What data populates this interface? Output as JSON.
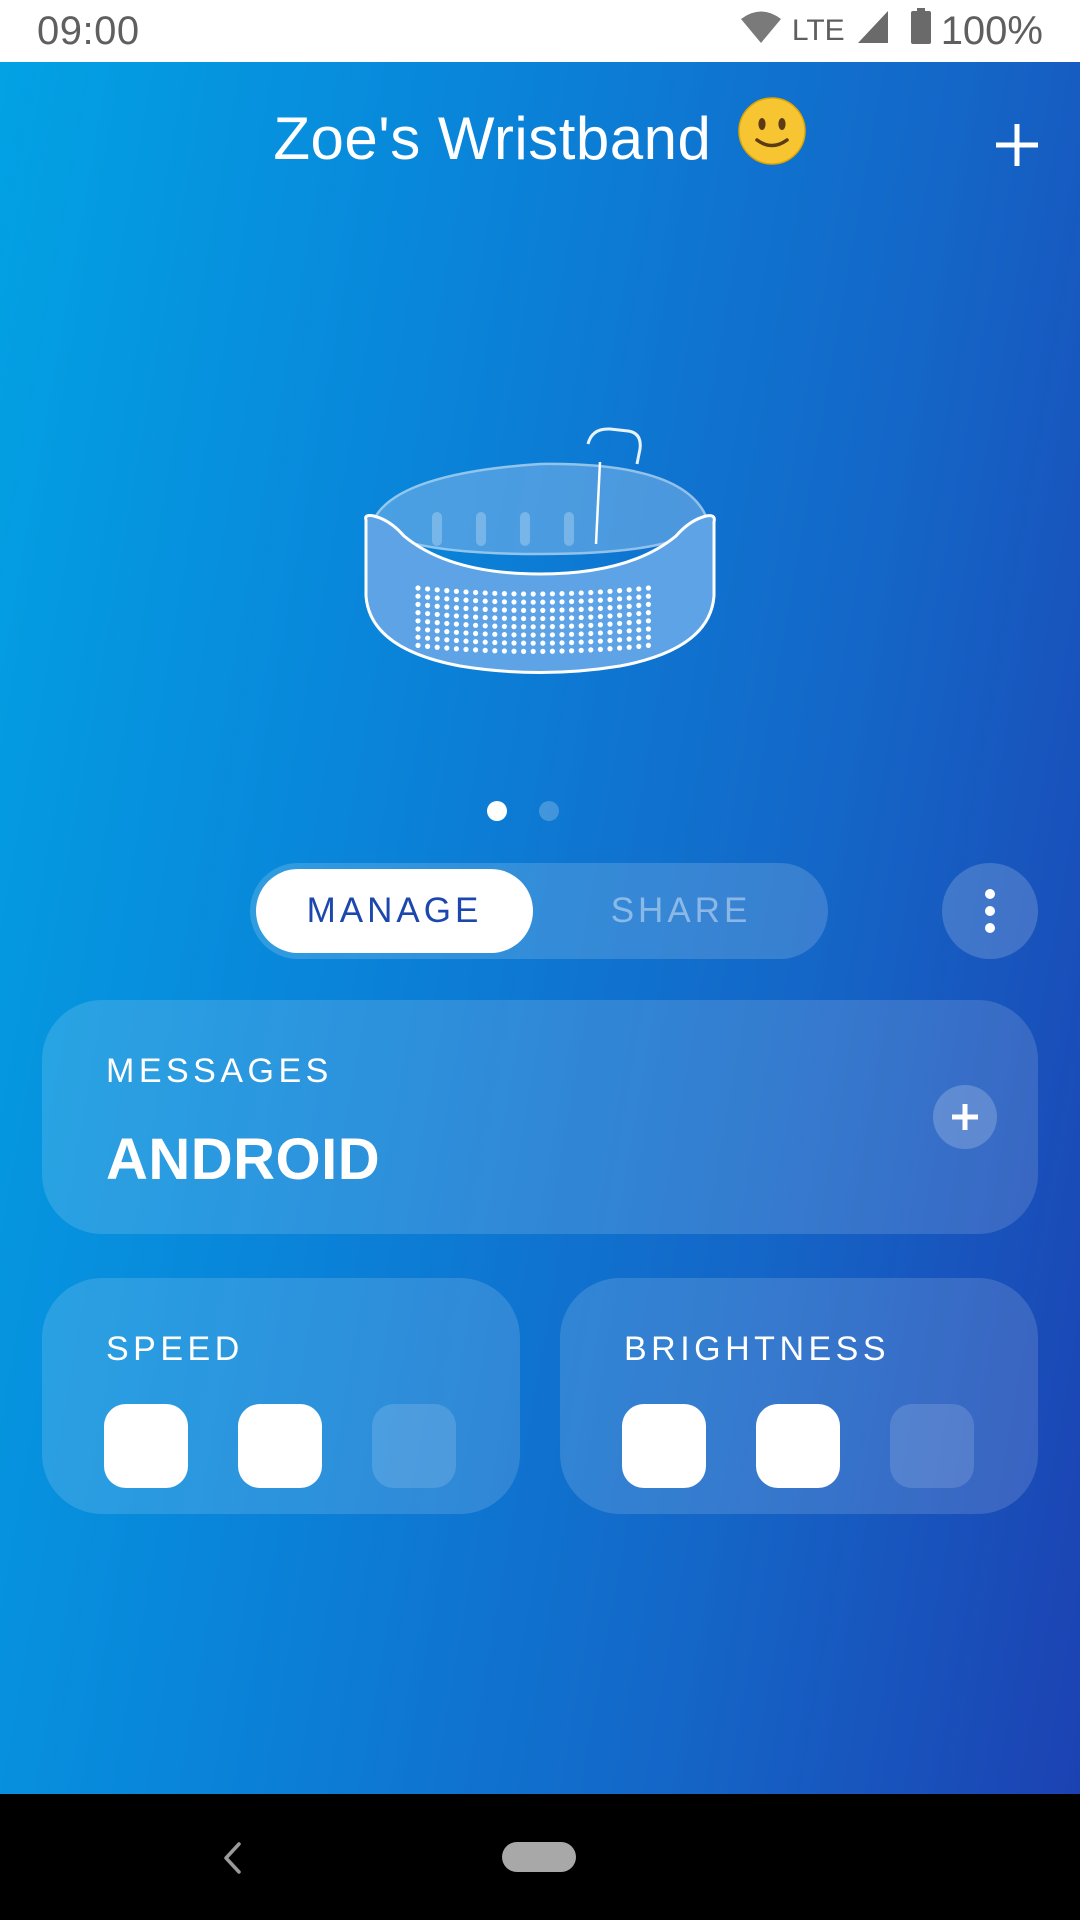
{
  "status_bar": {
    "time": "09:00",
    "network": "LTE",
    "battery": "100%",
    "icons": [
      "wifi-icon",
      "cell-signal-icon",
      "battery-icon"
    ]
  },
  "header": {
    "title": "Zoe's Wristband",
    "emoji": "🙂",
    "add_icon": "plus-icon"
  },
  "pager": {
    "pages": 2,
    "active_index": 0
  },
  "tabs": {
    "manage_label": "MANAGE",
    "share_label": "SHARE",
    "selected": "MANAGE"
  },
  "more_icon": "more-vert-icon",
  "messages_card": {
    "label": "MESSAGES",
    "value": "ANDROID",
    "add_icon": "plus-icon"
  },
  "speed_card": {
    "label": "SPEED",
    "level": 2,
    "max_level": 3
  },
  "brightness_card": {
    "label": "BRIGHTNESS",
    "level": 2,
    "max_level": 3
  },
  "nav_bar": {
    "back_icon": "back-chevron-icon",
    "home_icon": "home-pill-icon"
  },
  "colors": {
    "gradient_start": "#02a2e4",
    "gradient_end": "#1c42b2",
    "accent_text": "#1c48ad",
    "status_text": "#5f5f5f"
  }
}
